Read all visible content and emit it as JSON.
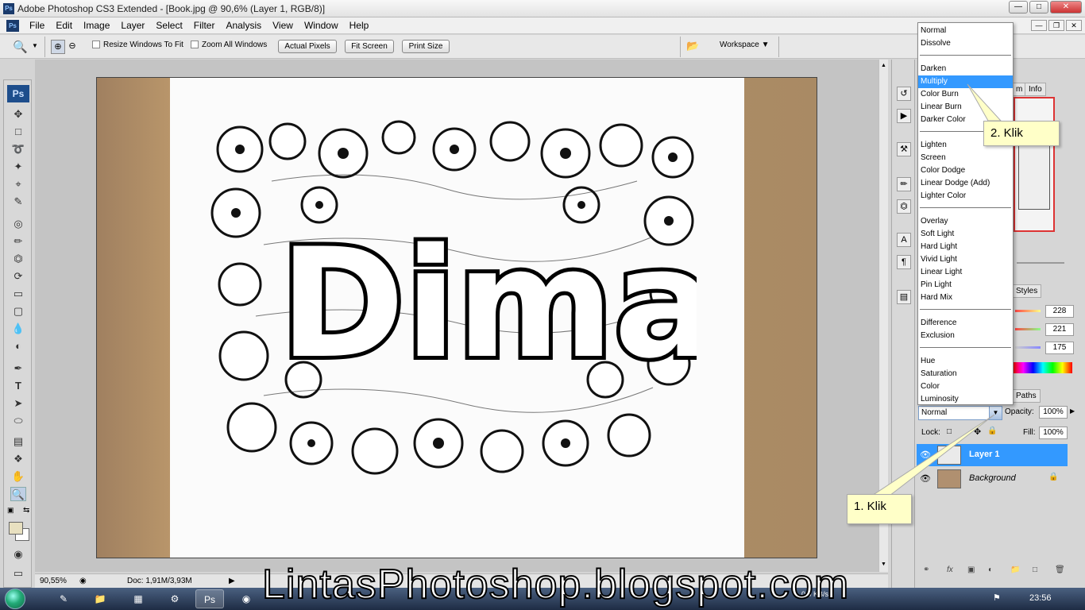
{
  "window": {
    "title": "Adobe Photoshop CS3 Extended - [Book.jpg @ 90,6% (Layer 1, RGB/8)]",
    "ps_icon": "Ps"
  },
  "menu": [
    "File",
    "Edit",
    "Image",
    "Layer",
    "Select",
    "Filter",
    "Analysis",
    "View",
    "Window",
    "Help"
  ],
  "options": {
    "resize_windows": "Resize Windows To Fit",
    "zoom_all": "Zoom All Windows",
    "actual_pixels": "Actual Pixels",
    "fit_screen": "Fit Screen",
    "print_size": "Print Size",
    "workspace": "Workspace"
  },
  "toolbox": {
    "logo": "Ps"
  },
  "status": {
    "zoom": "90,55%",
    "doc": "Doc: 1,91M/3,93M"
  },
  "panels": {
    "tab_m": "m",
    "tab_info": "Info",
    "tab_styles": "Styles",
    "tab_paths": "Paths",
    "rgb": [
      "228",
      "221",
      "175"
    ],
    "blend_current": "Normal",
    "opacity_label": "Opacity:",
    "opacity_value": "100%",
    "lock_label": "Lock:",
    "fill_label": "Fill:",
    "fill_value": "100%"
  },
  "layers": [
    {
      "name": "Layer 1",
      "selected": true
    },
    {
      "name": "Background",
      "selected": false
    }
  ],
  "blend_modes": [
    [
      "Normal",
      "Dissolve"
    ],
    [
      "Darken",
      "Multiply",
      "Color Burn",
      "Linear Burn",
      "Darker Color"
    ],
    [
      "Lighten",
      "Screen",
      "Color Dodge",
      "Linear Dodge (Add)",
      "Lighter Color"
    ],
    [
      "Overlay",
      "Soft Light",
      "Hard Light",
      "Vivid Light",
      "Linear Light",
      "Pin Light",
      "Hard Mix"
    ],
    [
      "Difference",
      "Exclusion"
    ],
    [
      "Hue",
      "Saturation",
      "Color",
      "Luminosity"
    ]
  ],
  "blend_selected": "Multiply",
  "callouts": {
    "step1": "1. Klik",
    "step2": "2. Klik"
  },
  "artwork_text": "Dimas",
  "taskbar": {
    "clock": "23:56",
    "net": "0.0 KB/s"
  },
  "watermark": "LintasPhotoshop.blogspot.com",
  "colors": {
    "selection": "#3399ff",
    "callout": "#ffffc8",
    "ps_blue": "#1e4e8c"
  }
}
